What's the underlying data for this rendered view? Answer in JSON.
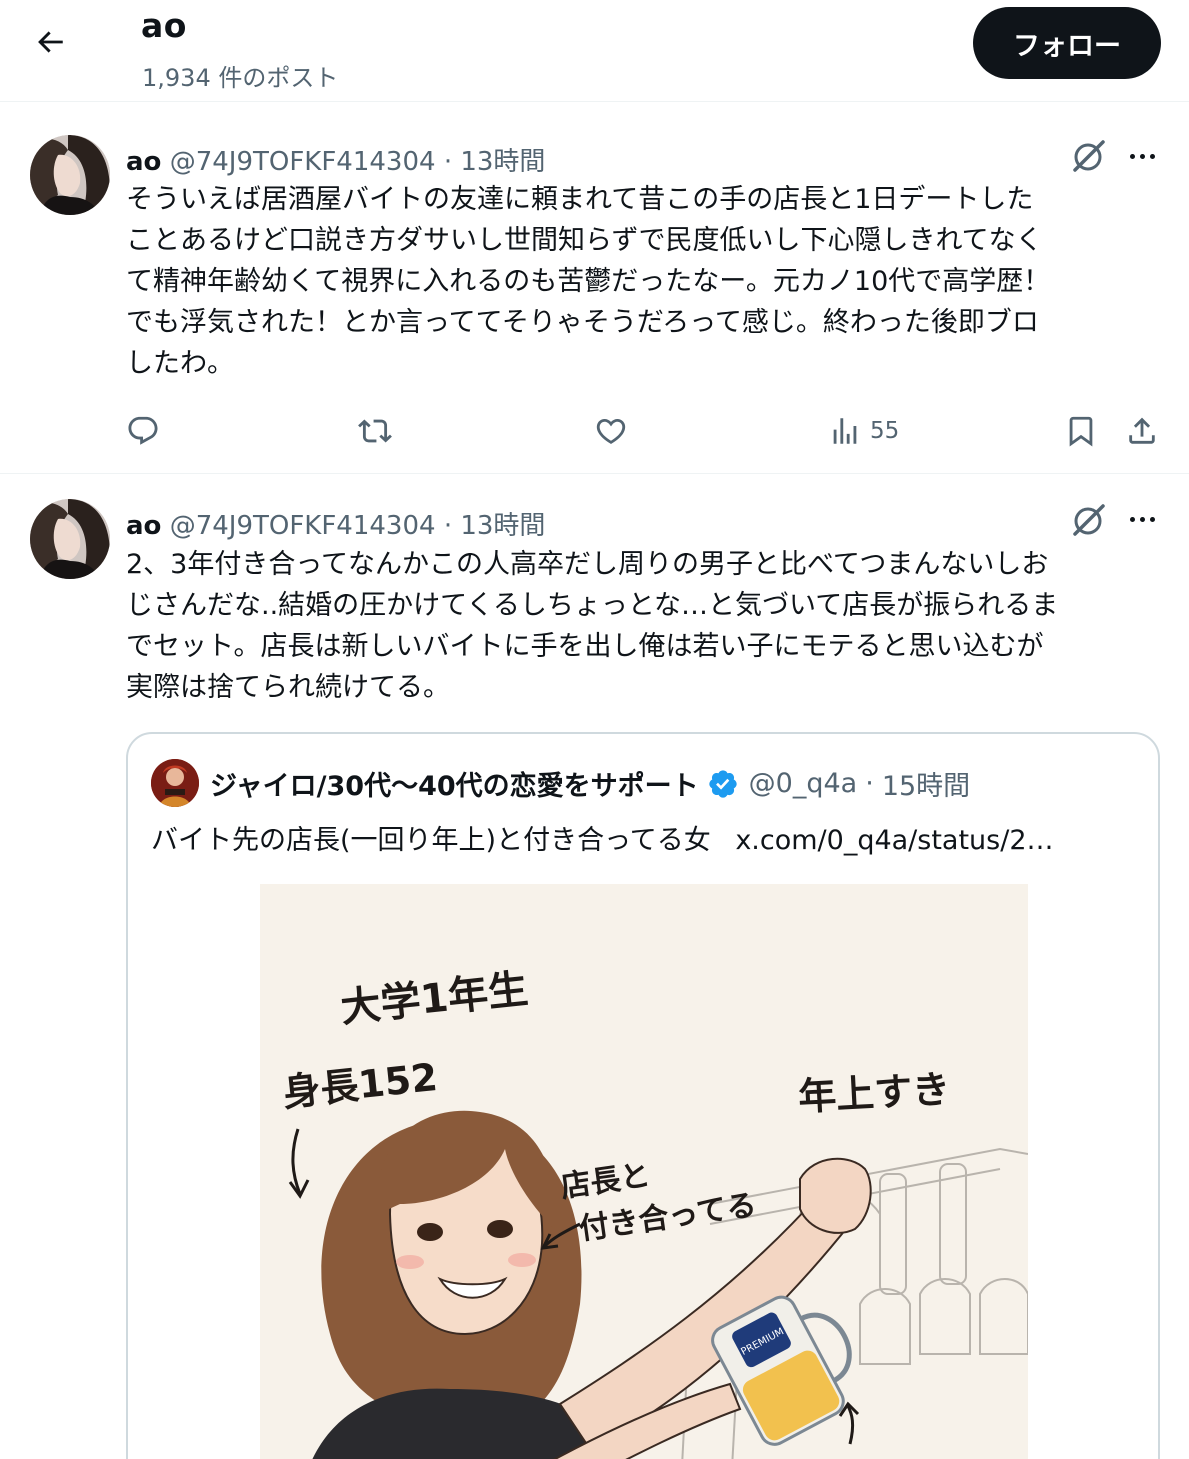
{
  "header": {
    "title": "ao",
    "post_count": "1,934 件のポスト",
    "follow_label": "フォロー"
  },
  "tweets": [
    {
      "name": "ao",
      "handle": "@74J9TOFKF414304",
      "separator": "·",
      "time": "13時間",
      "lines": [
        "そういえば居酒屋バイトの友達に頼まれて昔この手の店長と1日デートした",
        "ことあるけど口説き方ダサいし世間知らずで民度低いし下心隠しきれてなく",
        "て精神年齢幼くて視界に入れるのも苦鬱だったなー。元カノ10代で高学歴！",
        "でも浮気された！とか言っててそりゃそうだろって感じ。終わった後即ブロ",
        "したわ。"
      ],
      "views": "55"
    },
    {
      "name": "ao",
      "handle": "@74J9TOFKF414304",
      "separator": "·",
      "time": "13時間",
      "lines": [
        "2、3年付き合ってなんかこの人高卒だし周りの男子と比べてつまんないしお",
        "じさんだな..結婚の圧かけてくるしちょっとな…と気づいて店長が振られるま",
        "でセット。店長は新しいバイトに手を出し俺は若い子にモテると思い込むが",
        "実際は捨てられ続けてる。"
      ],
      "quote": {
        "name": "ジャイロ/30代〜40代の恋愛をサポート",
        "handle": "@0_q4a",
        "separator": "·",
        "time": "15時間",
        "text": "バイト先の店長(一回り年上)と付き合ってる女",
        "link": "x.com/0_q4a/status/2…",
        "image_texts": {
          "grade": "大学1年生",
          "height": "身長152",
          "likes": "年上すき",
          "dating_line1": "店長と",
          "dating_line2": "付き合ってる",
          "mug_label": "PREMIUM"
        }
      }
    }
  ],
  "icons": [
    "back-arrow-icon",
    "grok-icon",
    "more-icon",
    "reply-icon",
    "repost-icon",
    "like-icon",
    "views-icon",
    "bookmark-icon",
    "share-icon",
    "verified-badge-icon"
  ],
  "colors": {
    "text": "#0f1419",
    "secondary": "#536471",
    "border": "#eff3f4",
    "verified": "#1d9bf0",
    "follow_bg": "#0f1419"
  }
}
